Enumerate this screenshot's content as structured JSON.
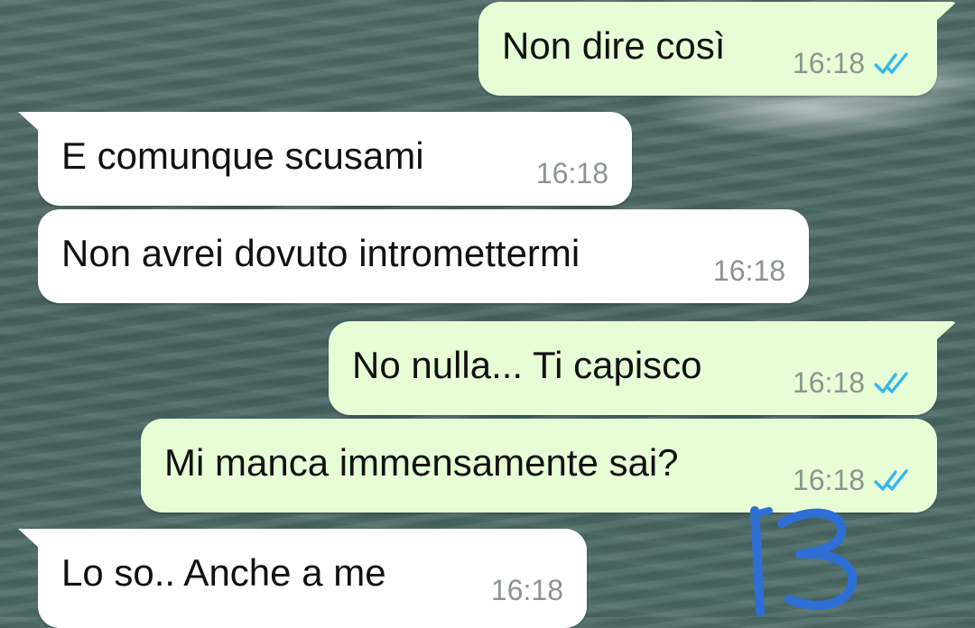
{
  "accent": {
    "outgoing_bubble": "#e7fdd6",
    "incoming_bubble": "#ffffff",
    "read_ticks": "#34b7f1"
  },
  "messages": [
    {
      "direction": "out",
      "text": "Non dire così",
      "time": "16:18",
      "status": "read"
    },
    {
      "direction": "in",
      "text": "E comunque scusami",
      "time": "16:18"
    },
    {
      "direction": "in",
      "text": "Non avrei dovuto intromettermi",
      "time": "16:18"
    },
    {
      "direction": "out",
      "text": "No nulla... Ti capisco",
      "time": "16:18",
      "status": "read"
    },
    {
      "direction": "out",
      "text": "Mi manca immensamente sai?",
      "time": "16:18",
      "status": "read"
    },
    {
      "direction": "in",
      "text": "Lo so.. Anche a me",
      "time": "16:18"
    }
  ],
  "handwritten_mark": "13"
}
